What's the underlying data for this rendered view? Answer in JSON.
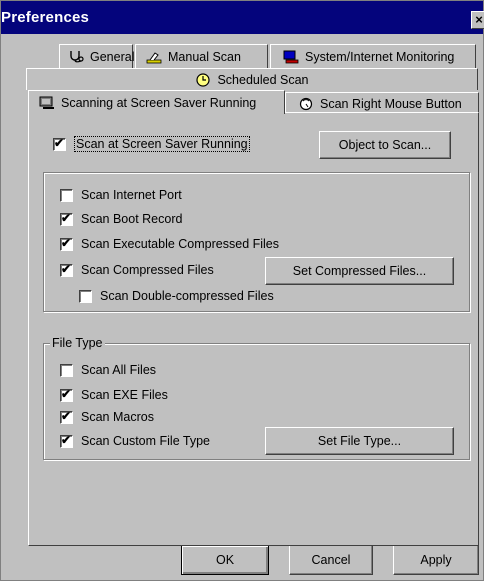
{
  "window": {
    "title": "Preferences",
    "close_glyph": "×"
  },
  "tabs": [
    {
      "label": "General",
      "icon": "stethoscope-icon"
    },
    {
      "label": "Manual Scan",
      "icon": "hand-scan-icon"
    },
    {
      "label": "System/Internet Monitoring",
      "icon": "monitor-icon"
    },
    {
      "label": "Scheduled Scan",
      "icon": "clock-icon"
    },
    {
      "label": "Scanning at Screen Saver Running",
      "icon": "screensaver-icon",
      "active": true
    },
    {
      "label": "Scan Right Mouse Button",
      "icon": "mouse-icon"
    }
  ],
  "main": {
    "scan_screensaver": {
      "label": "Scan at Screen Saver Running",
      "checked": true
    },
    "object_to_scan_button": "Object to Scan...",
    "options": [
      {
        "label": "Scan Internet Port",
        "checked": false
      },
      {
        "label": "Scan Boot Record",
        "checked": true
      },
      {
        "label": "Scan Executable Compressed Files",
        "checked": true
      },
      {
        "label": "Scan Compressed Files",
        "checked": true
      },
      {
        "label": "Scan Double-compressed Files",
        "checked": false
      }
    ],
    "set_compressed_button": "Set Compressed Files...",
    "file_type": {
      "legend": "File Type",
      "items": [
        {
          "label": "Scan All Files",
          "checked": false
        },
        {
          "label": "Scan EXE Files",
          "checked": true
        },
        {
          "label": "Scan Macros",
          "checked": true
        },
        {
          "label": "Scan Custom File Type",
          "checked": true
        }
      ],
      "set_file_type_button": "Set File Type..."
    }
  },
  "footer": {
    "ok": "OK",
    "cancel": "Cancel",
    "apply": "Apply"
  },
  "colors": {
    "titlebar": "#04047c",
    "face": "#c0c0c0"
  }
}
